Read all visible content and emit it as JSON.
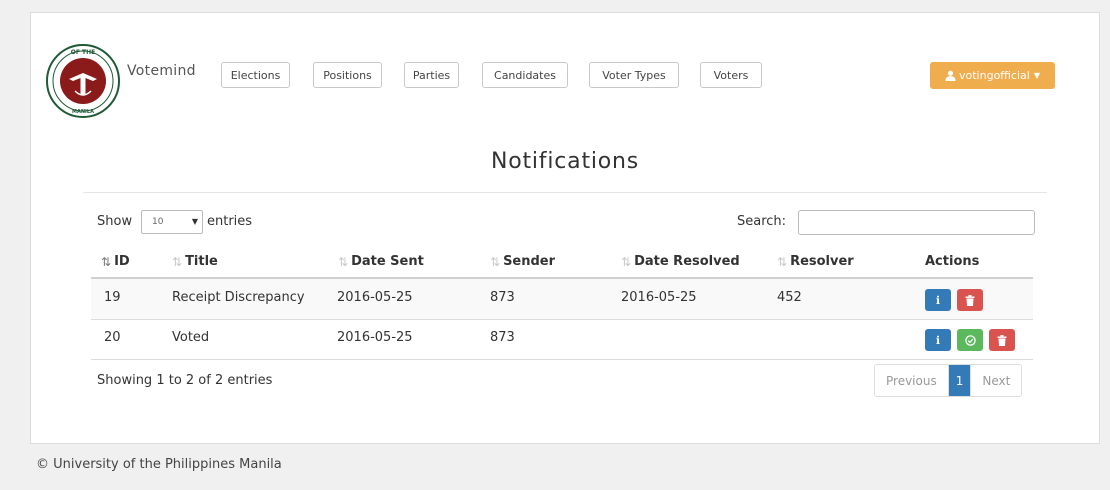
{
  "brand": {
    "name": "Votemind",
    "logo_text_top": "OF THE",
    "logo_text_bottom": "MANILA"
  },
  "nav": {
    "items": [
      {
        "label": "Elections"
      },
      {
        "label": "Positions"
      },
      {
        "label": "Parties"
      },
      {
        "label": "Candidates"
      },
      {
        "label": "Voter Types"
      },
      {
        "label": "Voters"
      }
    ]
  },
  "user": {
    "label": "votingofficial",
    "icon": "user-icon"
  },
  "page": {
    "title": "Notifications"
  },
  "table_controls": {
    "show_label": "Show",
    "entries_value": "10",
    "entries_label": "entries",
    "search_label": "Search:",
    "search_value": ""
  },
  "table": {
    "columns": [
      "ID",
      "Title",
      "Date Sent",
      "Sender",
      "Date Resolved",
      "Resolver",
      "Actions"
    ],
    "rows": [
      {
        "id": "19",
        "title": "Receipt Discrepancy",
        "date_sent": "2016-05-25",
        "sender": "873",
        "date_resolved": "2016-05-25",
        "resolver": "452",
        "actions": [
          "info",
          "delete"
        ]
      },
      {
        "id": "20",
        "title": "Voted",
        "date_sent": "2016-05-25",
        "sender": "873",
        "date_resolved": "",
        "resolver": "",
        "actions": [
          "info",
          "resolve",
          "delete"
        ]
      }
    ],
    "info": "Showing 1 to 2 of 2 entries"
  },
  "pagination": {
    "previous": "Previous",
    "current": "1",
    "next": "Next"
  },
  "footer": {
    "text": "© University of the Philippines Manila"
  },
  "colors": {
    "primary": "#337ab7",
    "warning": "#f0ad4e",
    "danger": "#d9534f",
    "success": "#5cb85c",
    "seal_red": "#8b1a1a",
    "seal_green": "#1f5a36"
  }
}
